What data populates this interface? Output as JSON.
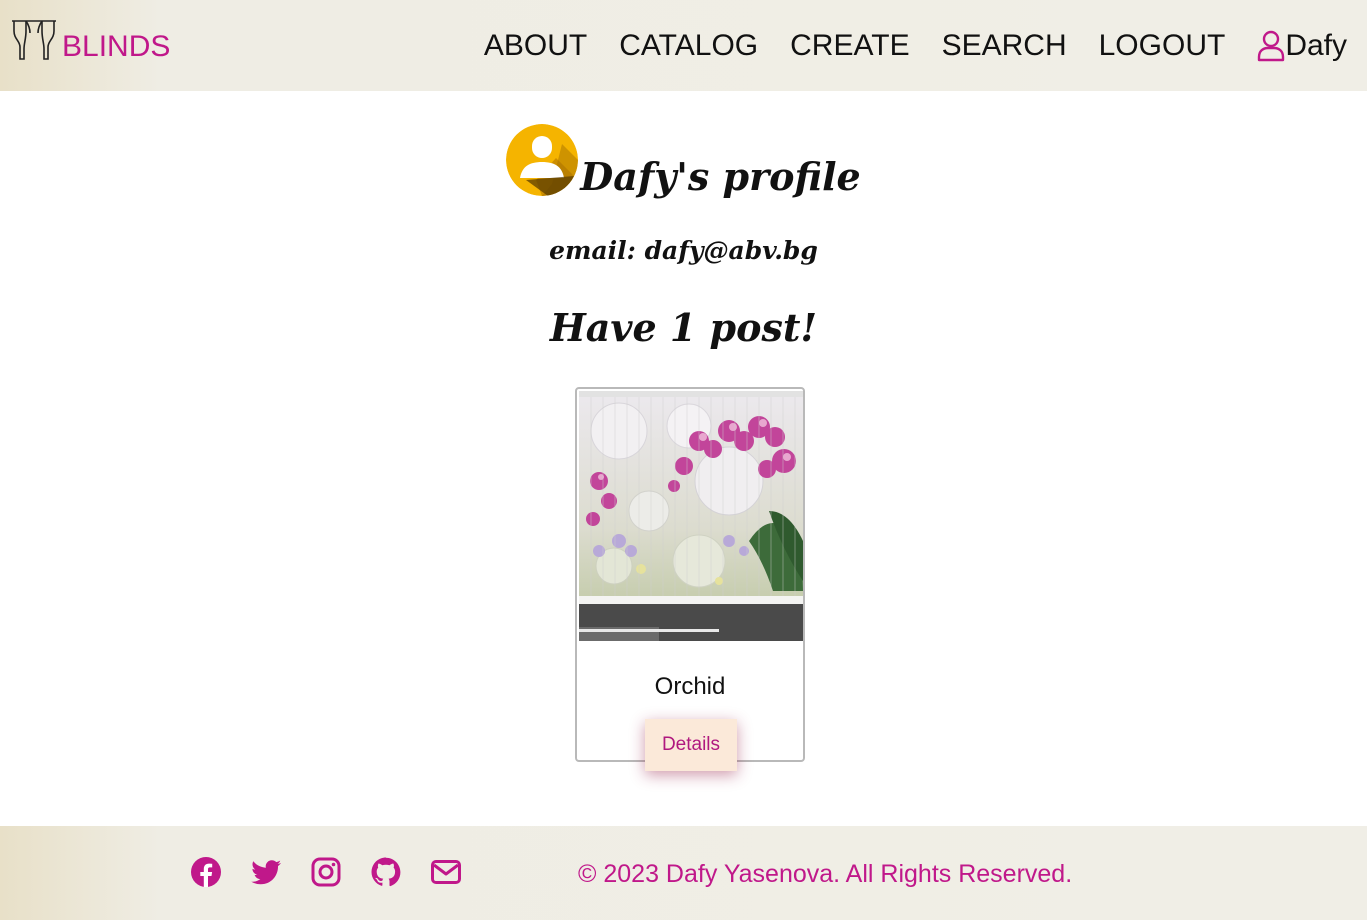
{
  "header": {
    "logo_text": "BLINDS",
    "logo_icon": "curtains-icon",
    "nav": {
      "about": "ABOUT",
      "catalog": "CATALOG",
      "create": "CREATE",
      "search": "SEARCH",
      "logout": "LOGOUT"
    },
    "user_icon": "user-icon",
    "username": "Dafy"
  },
  "profile": {
    "avatar_icon": "user-avatar-icon",
    "title": "Dafy's profile",
    "email": "email: dafy@abv.bg",
    "posts_count": "Have 1 post!"
  },
  "posts": [
    {
      "image": "orchid-blinds-photo",
      "title": "Orchid",
      "details_label": "Details"
    }
  ],
  "footer": {
    "socials": [
      "facebook-icon",
      "twitter-icon",
      "instagram-icon",
      "github-icon",
      "envelope-icon"
    ],
    "copyright": "© 2023 Dafy Yasenova. All Rights Reserved."
  },
  "colors": {
    "accent": "#c0188a",
    "header_bg": "#f0eee6",
    "button_bg": "#fbe9d9",
    "avatar": "#f5b400"
  }
}
